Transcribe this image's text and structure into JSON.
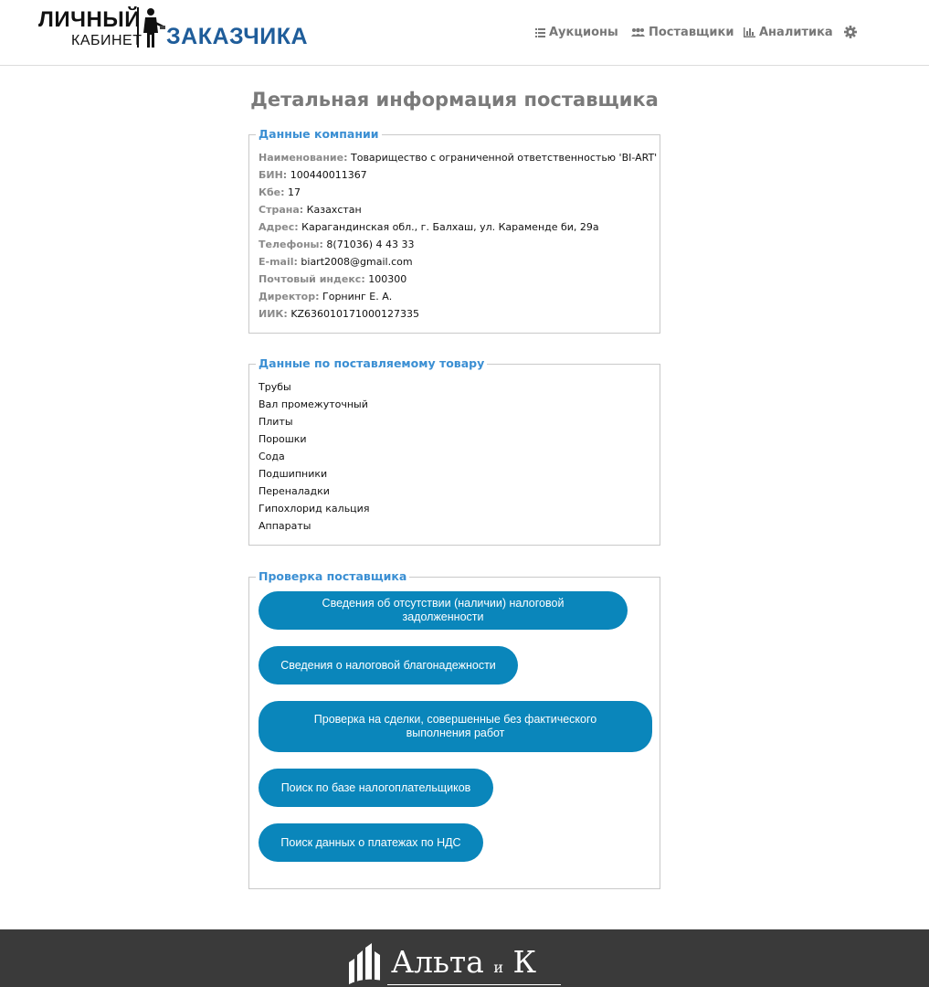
{
  "logo": {
    "line1": "ЛИЧНЫЙ",
    "line2": "КАБИНЕТ",
    "line3": "ЗАКАЗЧИКА",
    "accent": "#1f5d9a"
  },
  "nav": {
    "auctions": "Аукционы",
    "suppliers": "Поставщики",
    "analytics": "Аналитика",
    "icons": [
      "list-icon",
      "users-icon",
      "bar-chart-icon",
      "gear-icon"
    ]
  },
  "page": {
    "title": "Детальная информация поставщика"
  },
  "company": {
    "legend": "Данные компании",
    "rows": [
      {
        "label": "Наименование:",
        "value": "Товарищество с ограниченной ответственностью 'BI-ART'"
      },
      {
        "label": "БИН:",
        "value": "100440011367"
      },
      {
        "label": "Кбе:",
        "value": "17"
      },
      {
        "label": "Страна:",
        "value": "Казахстан"
      },
      {
        "label": "Адрес:",
        "value": "Карагандинская обл., г. Балхаш, ул. Караменде би, 29а"
      },
      {
        "label": "Телефоны:",
        "value": "8(71036) 4 43 33"
      },
      {
        "label": "E-mail:",
        "value": "biart2008@gmail.com"
      },
      {
        "label": "Почтовый индекс:",
        "value": "100300"
      },
      {
        "label": "Директор:",
        "value": "Горнинг Е. А."
      },
      {
        "label": "ИИК:",
        "value": "KZ636010171000127335"
      }
    ]
  },
  "goods": {
    "legend": "Данные по поставляемому товару",
    "items": [
      "Трубы",
      "Вал промежуточный",
      "Плиты",
      "Порошки",
      "Сода",
      "Подшипники",
      "Переналадки",
      "Гипохлорид кальция",
      "Аппараты"
    ]
  },
  "check": {
    "legend": "Проверка поставщика",
    "buttons": [
      "Сведения об отсутствии (наличии) налоговой задолженности",
      "Сведения о налоговой благонадежности",
      "Проверка на сделки, совершенные без фактического выполнения работ",
      "Поиск по базе налогоплательщиков",
      "Поиск данных о платежах по НДС"
    ],
    "button_color": "#0a86bb"
  },
  "footer": {
    "brand_main": "Альта",
    "brand_and": "и",
    "brand_k": "К"
  }
}
